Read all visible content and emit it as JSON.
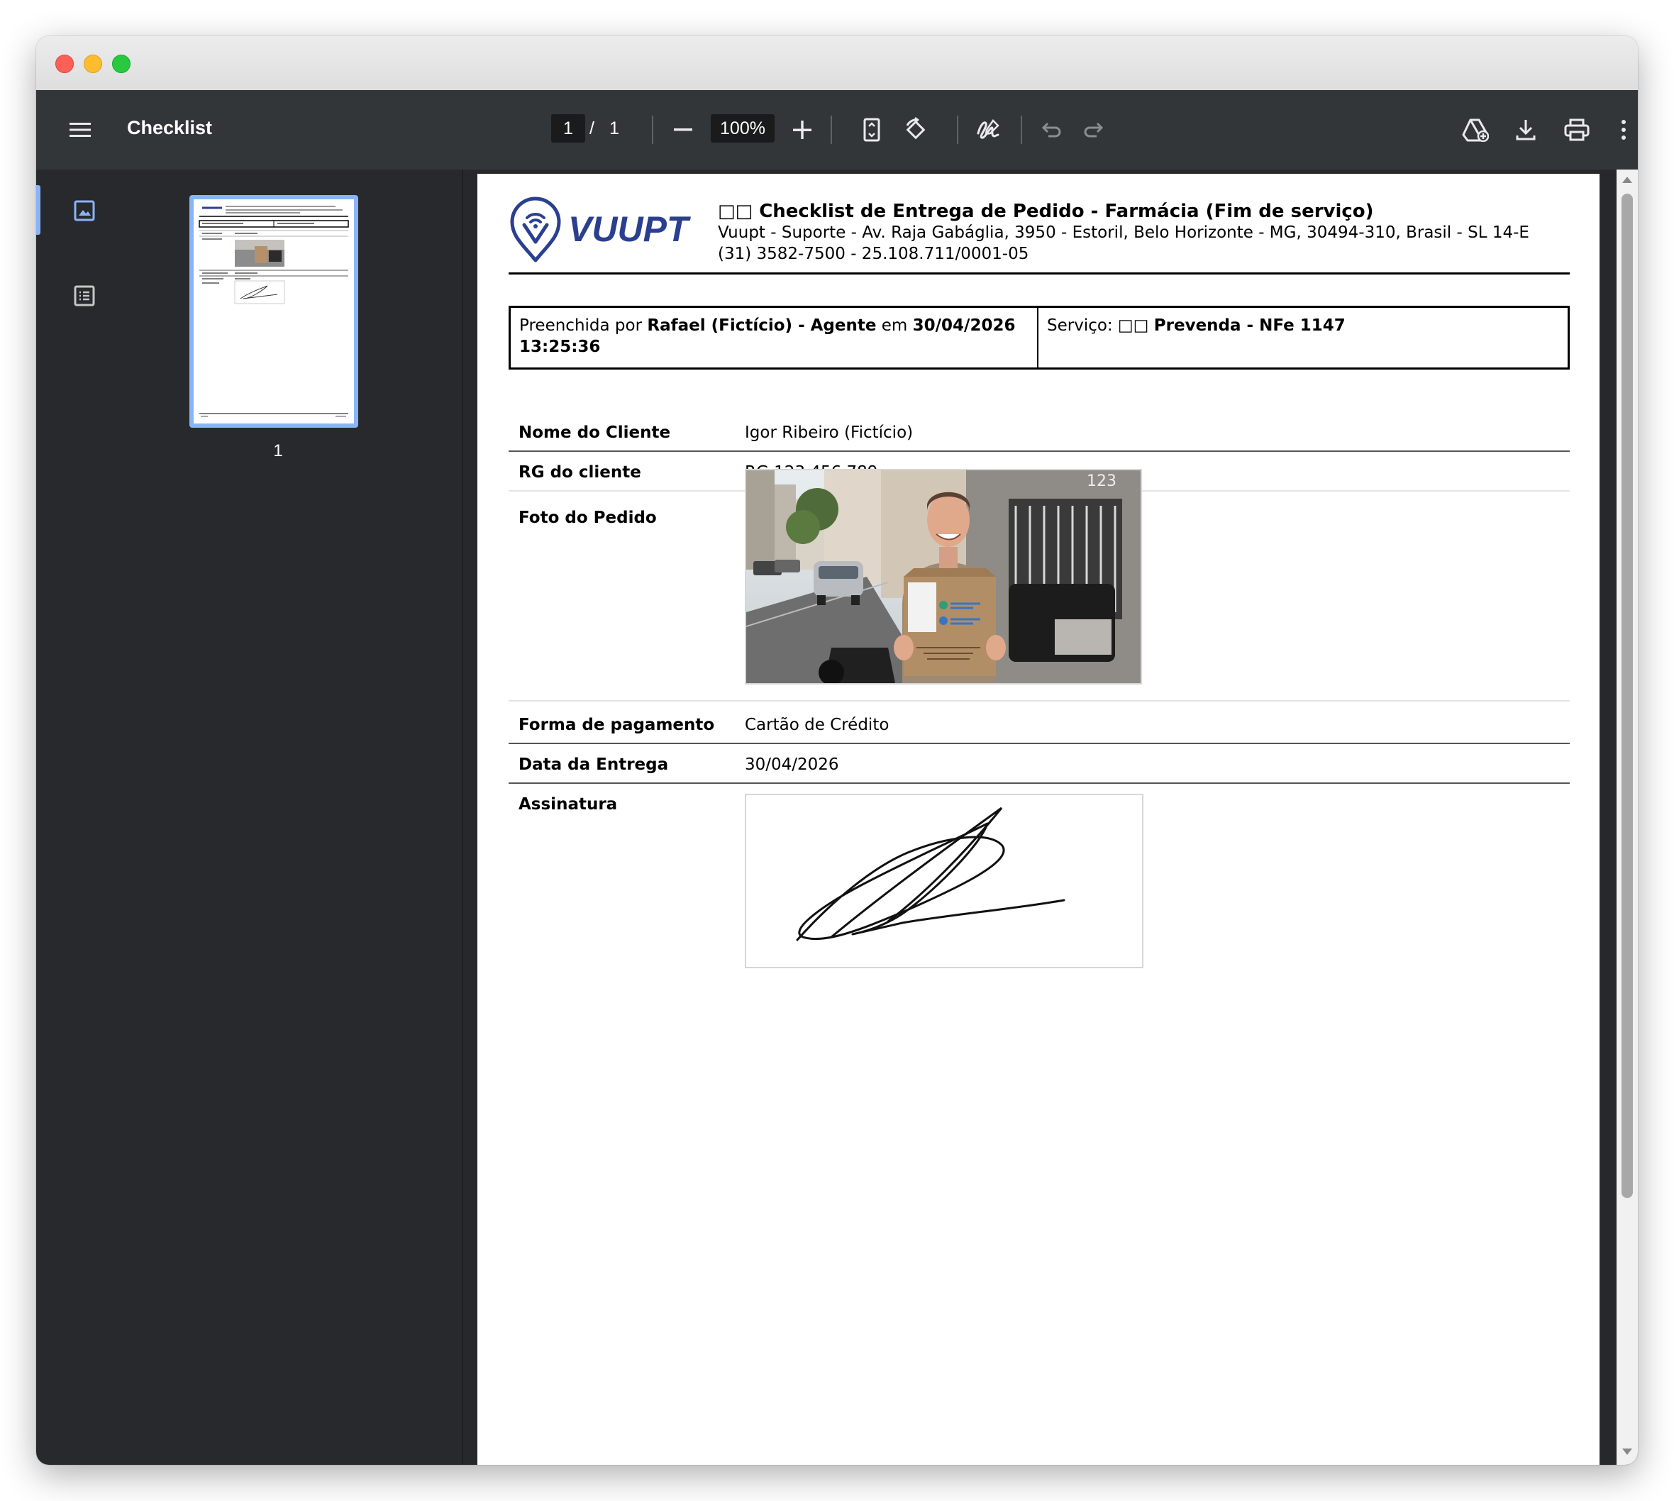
{
  "toolbar": {
    "title": "Checklist",
    "page_current": "1",
    "page_separator": "/",
    "page_total": "1",
    "zoom": "100%"
  },
  "sidebar": {
    "thumbnail_page_label": "1"
  },
  "document": {
    "logo_text": "VUUPT",
    "title_icon": "□□",
    "title": "Checklist de Entrega de Pedido - Farmácia (Fim de serviço)",
    "subtitle_line1": "Vuupt - Suporte - Av. Raja Gabáglia, 3950 - Estoril, Belo Horizonte - MG, 30494-310, Brasil - SL 14-E",
    "subtitle_line2": "(31) 3582-7500 - 25.108.711/0001-05",
    "meta": {
      "filled_prefix": "Preenchida por ",
      "filled_by": "Rafael (Fictício) - Agente",
      "filled_mid": " em ",
      "filled_date": "30/04/2026",
      "filled_time": "13:25:36",
      "service_prefix": "Serviço: ",
      "service_icon": "□□",
      "service_name": "Prevenda - NFe 1147"
    },
    "fields": [
      {
        "label": "Nome do Cliente",
        "value": "Igor Ribeiro (Fictício)"
      },
      {
        "label": "RG do cliente",
        "value": "RG 123.456.789"
      },
      {
        "label": "Foto do Pedido",
        "value": ""
      },
      {
        "label": "Forma de pagamento",
        "value": "Cartão de Crédito"
      },
      {
        "label": "Data da Entrega",
        "value": "30/04/2026"
      },
      {
        "label": "Assinatura",
        "value": ""
      }
    ],
    "photo_house_number": "123"
  },
  "colors": {
    "toolbar_bg": "#333639",
    "sidebar_bg": "#28292c",
    "accent": "#8ab4f8",
    "logo_blue": "#2b3f8f"
  },
  "icons": [
    "menu-icon",
    "zoom-out-icon",
    "zoom-in-icon",
    "fit-page-icon",
    "rotate-icon",
    "annotate-icon",
    "undo-icon",
    "redo-icon",
    "drive-icon",
    "download-icon",
    "print-icon",
    "more-icon",
    "thumbnails-icon",
    "outline-icon"
  ]
}
